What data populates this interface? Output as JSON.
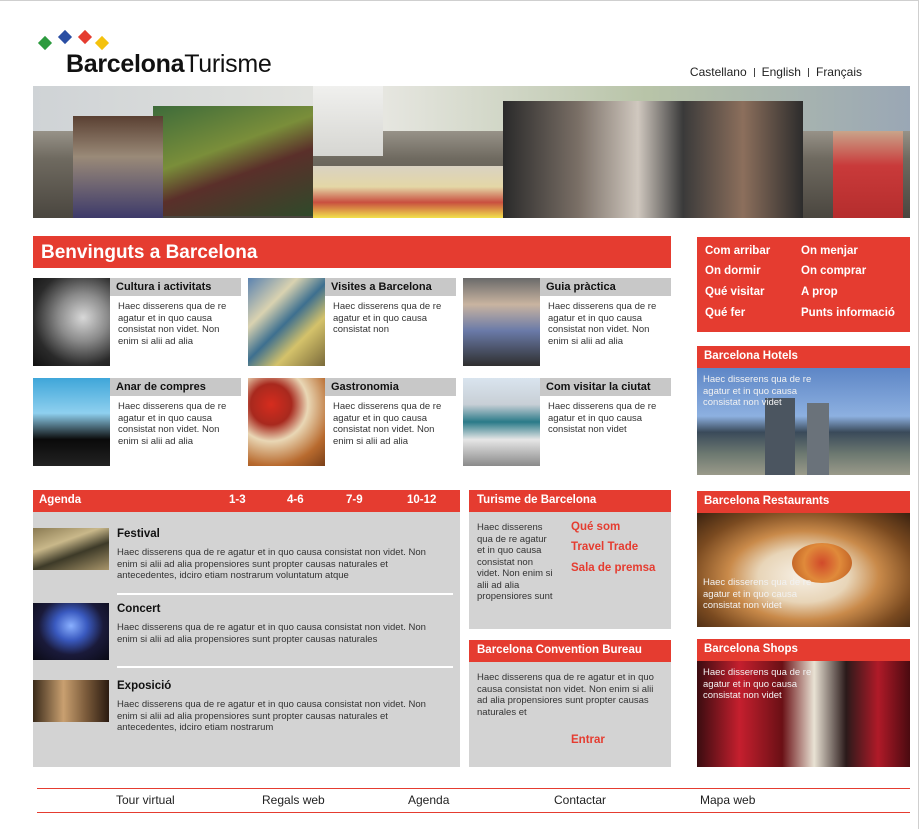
{
  "logo": {
    "bold": "Barcelona",
    "light": "Turisme"
  },
  "colors": {
    "accent": "#e53c30",
    "panel": "#d3d3d3",
    "diamond_green": "#2c9a3e",
    "diamond_blue": "#2a4ea3",
    "diamond_red": "#e53c30",
    "diamond_yellow": "#f4c20d"
  },
  "languages": [
    "Castellano",
    "English",
    "Français"
  ],
  "hero": {
    "icon": "street-market-photo"
  },
  "welcome_title": "Benvinguts a Barcelona",
  "tiles": [
    {
      "title": "Cultura i activitats",
      "text": "Haec disserens qua de re agatur et in quo causa consistat non videt. Non enim si alii ad alia"
    },
    {
      "title": "Visites a Barcelona",
      "text": "Haec disserens qua de re agatur et in quo causa consistat non"
    },
    {
      "title": "Guia pràctica",
      "text": "Haec disserens qua de re agatur et in quo causa consistat non videt. Non enim si alii ad alia"
    },
    {
      "title": "Anar de compres",
      "text": "Haec disserens qua de re agatur et in quo causa consistat non videt. Non enim si alii ad alia"
    },
    {
      "title": "Gastronomia",
      "text": "Haec disserens qua de re agatur et in quo causa consistat non videt. Non enim si alii ad alia"
    },
    {
      "title": "Com visitar la ciutat",
      "text": "Haec disserens qua de re agatur et in quo causa consistat non videt"
    }
  ],
  "quick_links": [
    "Com arribar",
    "On menjar",
    "On dormir",
    "On comprar",
    "Qué visitar",
    "A prop",
    "Qué fer",
    "Punts informació"
  ],
  "agenda": {
    "title": "Agenda",
    "ranges": [
      "1-3",
      "4-6",
      "7-9",
      "10-12"
    ],
    "events": [
      {
        "title": "Festival",
        "text": "Haec disserens qua de re agatur et in quo causa consistat non videt. Non enim si alii ad alia propensiores sunt propter causas naturales et antecedentes, idciro etiam nostrarum voluntatum atque"
      },
      {
        "title": "Concert",
        "text": "Haec disserens qua de re agatur et in quo causa consistat non videt. Non enim si alii ad alia propensiores sunt propter causas naturales"
      },
      {
        "title": "Exposició",
        "text": "Haec disserens qua de re agatur et in quo causa consistat non videt. Non enim si alii ad alia propensiores sunt propter causas naturales et antecedentes, idciro etiam nostrarum"
      }
    ]
  },
  "turisme": {
    "title": "Turisme de Barcelona",
    "text": "Haec disserens qua de re agatur et in quo causa consistat non videt. Non enim si alii ad alia propensiores sunt",
    "links": [
      "Qué som",
      "Travel Trade",
      "Sala de premsa"
    ]
  },
  "convention": {
    "title": "Barcelona Convention Bureau",
    "text": "Haec disserens qua de re agatur et in quo causa consistat non videt. Non enim si alii ad alia propensiores sunt propter causas naturales et",
    "link": "Entrar"
  },
  "side_boxes": [
    {
      "title": "Barcelona Hotels",
      "text": "Haec disserens qua de re agatur et in quo causa consistat non videt"
    },
    {
      "title": "Barcelona Restaurants",
      "text": "Haec disserens qua de re agatur et in quo causa consistat non videt"
    },
    {
      "title": "Barcelona Shops",
      "text": "Haec disserens qua de re agatur et in quo causa consistat non videt"
    }
  ],
  "footer": [
    "Tour virtual",
    "Regals web",
    "Agenda",
    "Contactar",
    "Mapa web"
  ]
}
